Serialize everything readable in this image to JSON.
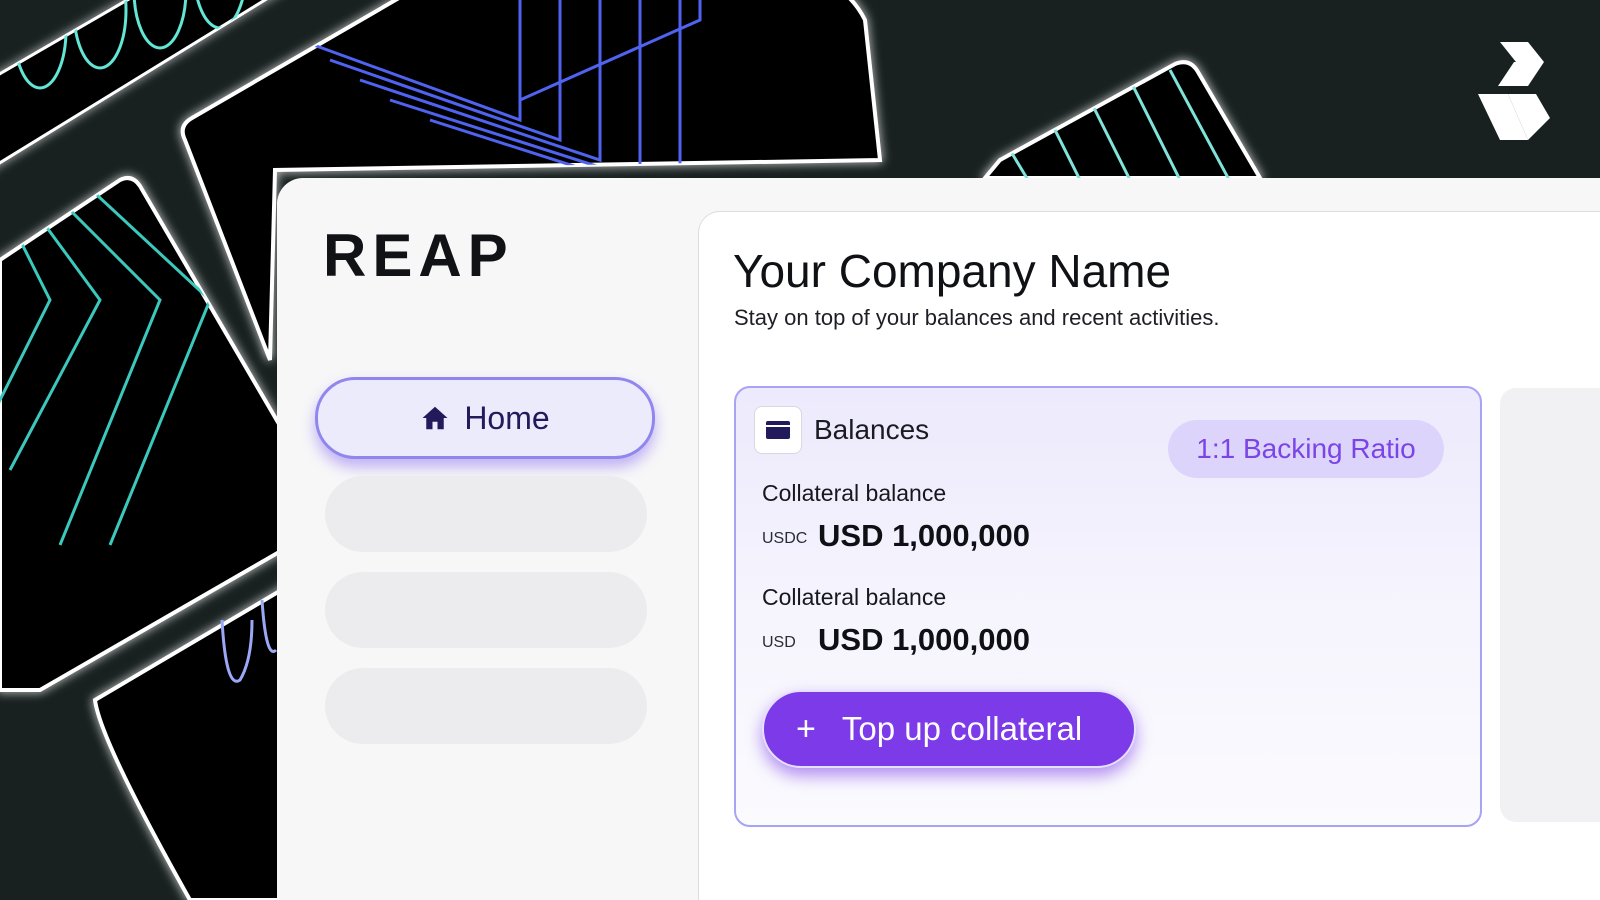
{
  "brand": {
    "logo_text": "REAP"
  },
  "nav": {
    "items": [
      {
        "label": "Home",
        "icon": "home-icon",
        "active": true
      }
    ]
  },
  "header": {
    "title": "Your Company Name",
    "subtitle": "Stay on top of your balances and recent activities."
  },
  "balances_card": {
    "title": "Balances",
    "icon": "wallet-icon",
    "badge": "1:1 Backing Ratio",
    "rows": [
      {
        "label": "Collateral balance",
        "currency": "USDC",
        "amount": "USD 1,000,000"
      },
      {
        "label": "Collateral balance",
        "currency": "USD",
        "amount": "USD 1,000,000"
      }
    ],
    "action_label": "Top up collateral",
    "action_icon": "plus-icon"
  },
  "colors": {
    "accent": "#7c3ae8",
    "badge_bg": "#ddd4fb",
    "badge_text": "#7b44e6",
    "nav_active_bg": "#ecebfc",
    "background": "#182020"
  }
}
